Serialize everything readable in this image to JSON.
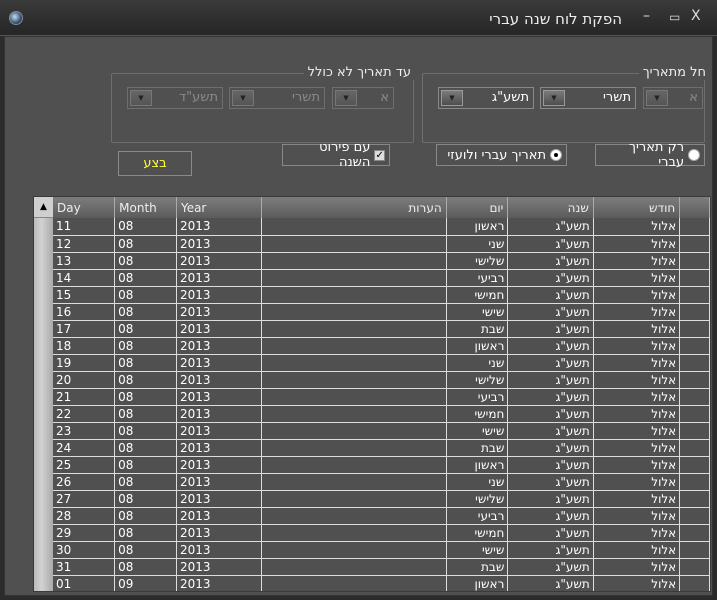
{
  "window": {
    "title": "הפקת לוח שנה עברי",
    "close": "X",
    "maximize": "▭",
    "minimize": "–"
  },
  "from_group": {
    "legend": "חל מתאריך",
    "day": "א",
    "month": "תשרי",
    "year": "תשע\"ג"
  },
  "to_group": {
    "legend": "עד תאריך לא כולל",
    "day": "א",
    "month": "תשרי",
    "year": "תשע\"ד"
  },
  "options": {
    "hebrew_only": "רק תאריך עברי",
    "hebrew_and_gregorian": "תאריך עברי ולועזי",
    "with_year_detail": "עם פירוט השנה",
    "checkmark": "✓"
  },
  "run_button": "בצע",
  "table": {
    "headers": {
      "day": "Day",
      "month": "Month",
      "year": "Year",
      "notes": "הערות",
      "weekday": "יום",
      "hyear": "שנה",
      "hmonth": "חודש"
    },
    "rows": [
      [
        "11",
        "08",
        "2013",
        "",
        "ראשון",
        "תשע\"ג",
        "אלול"
      ],
      [
        "12",
        "08",
        "2013",
        "",
        "שני",
        "תשע\"ג",
        "אלול"
      ],
      [
        "13",
        "08",
        "2013",
        "",
        "שלישי",
        "תשע\"ג",
        "אלול"
      ],
      [
        "14",
        "08",
        "2013",
        "",
        "רביעי",
        "תשע\"ג",
        "אלול"
      ],
      [
        "15",
        "08",
        "2013",
        "",
        "חמישי",
        "תשע\"ג",
        "אלול"
      ],
      [
        "16",
        "08",
        "2013",
        "",
        "שישי",
        "תשע\"ג",
        "אלול"
      ],
      [
        "17",
        "08",
        "2013",
        "",
        "שבת",
        "תשע\"ג",
        "אלול"
      ],
      [
        "18",
        "08",
        "2013",
        "",
        "ראשון",
        "תשע\"ג",
        "אלול"
      ],
      [
        "19",
        "08",
        "2013",
        "",
        "שני",
        "תשע\"ג",
        "אלול"
      ],
      [
        "20",
        "08",
        "2013",
        "",
        "שלישי",
        "תשע\"ג",
        "אלול"
      ],
      [
        "21",
        "08",
        "2013",
        "",
        "רביעי",
        "תשע\"ג",
        "אלול"
      ],
      [
        "22",
        "08",
        "2013",
        "",
        "חמישי",
        "תשע\"ג",
        "אלול"
      ],
      [
        "23",
        "08",
        "2013",
        "",
        "שישי",
        "תשע\"ג",
        "אלול"
      ],
      [
        "24",
        "08",
        "2013",
        "",
        "שבת",
        "תשע\"ג",
        "אלול"
      ],
      [
        "25",
        "08",
        "2013",
        "",
        "ראשון",
        "תשע\"ג",
        "אלול"
      ],
      [
        "26",
        "08",
        "2013",
        "",
        "שני",
        "תשע\"ג",
        "אלול"
      ],
      [
        "27",
        "08",
        "2013",
        "",
        "שלישי",
        "תשע\"ג",
        "אלול"
      ],
      [
        "28",
        "08",
        "2013",
        "",
        "רביעי",
        "תשע\"ג",
        "אלול"
      ],
      [
        "29",
        "08",
        "2013",
        "",
        "חמישי",
        "תשע\"ג",
        "אלול"
      ],
      [
        "30",
        "08",
        "2013",
        "",
        "שישי",
        "תשע\"ג",
        "אלול"
      ],
      [
        "31",
        "08",
        "2013",
        "",
        "שבת",
        "תשע\"ג",
        "אלול"
      ],
      [
        "01",
        "09",
        "2013",
        "",
        "ראשון",
        "תשע\"ג",
        "אלול"
      ]
    ]
  }
}
